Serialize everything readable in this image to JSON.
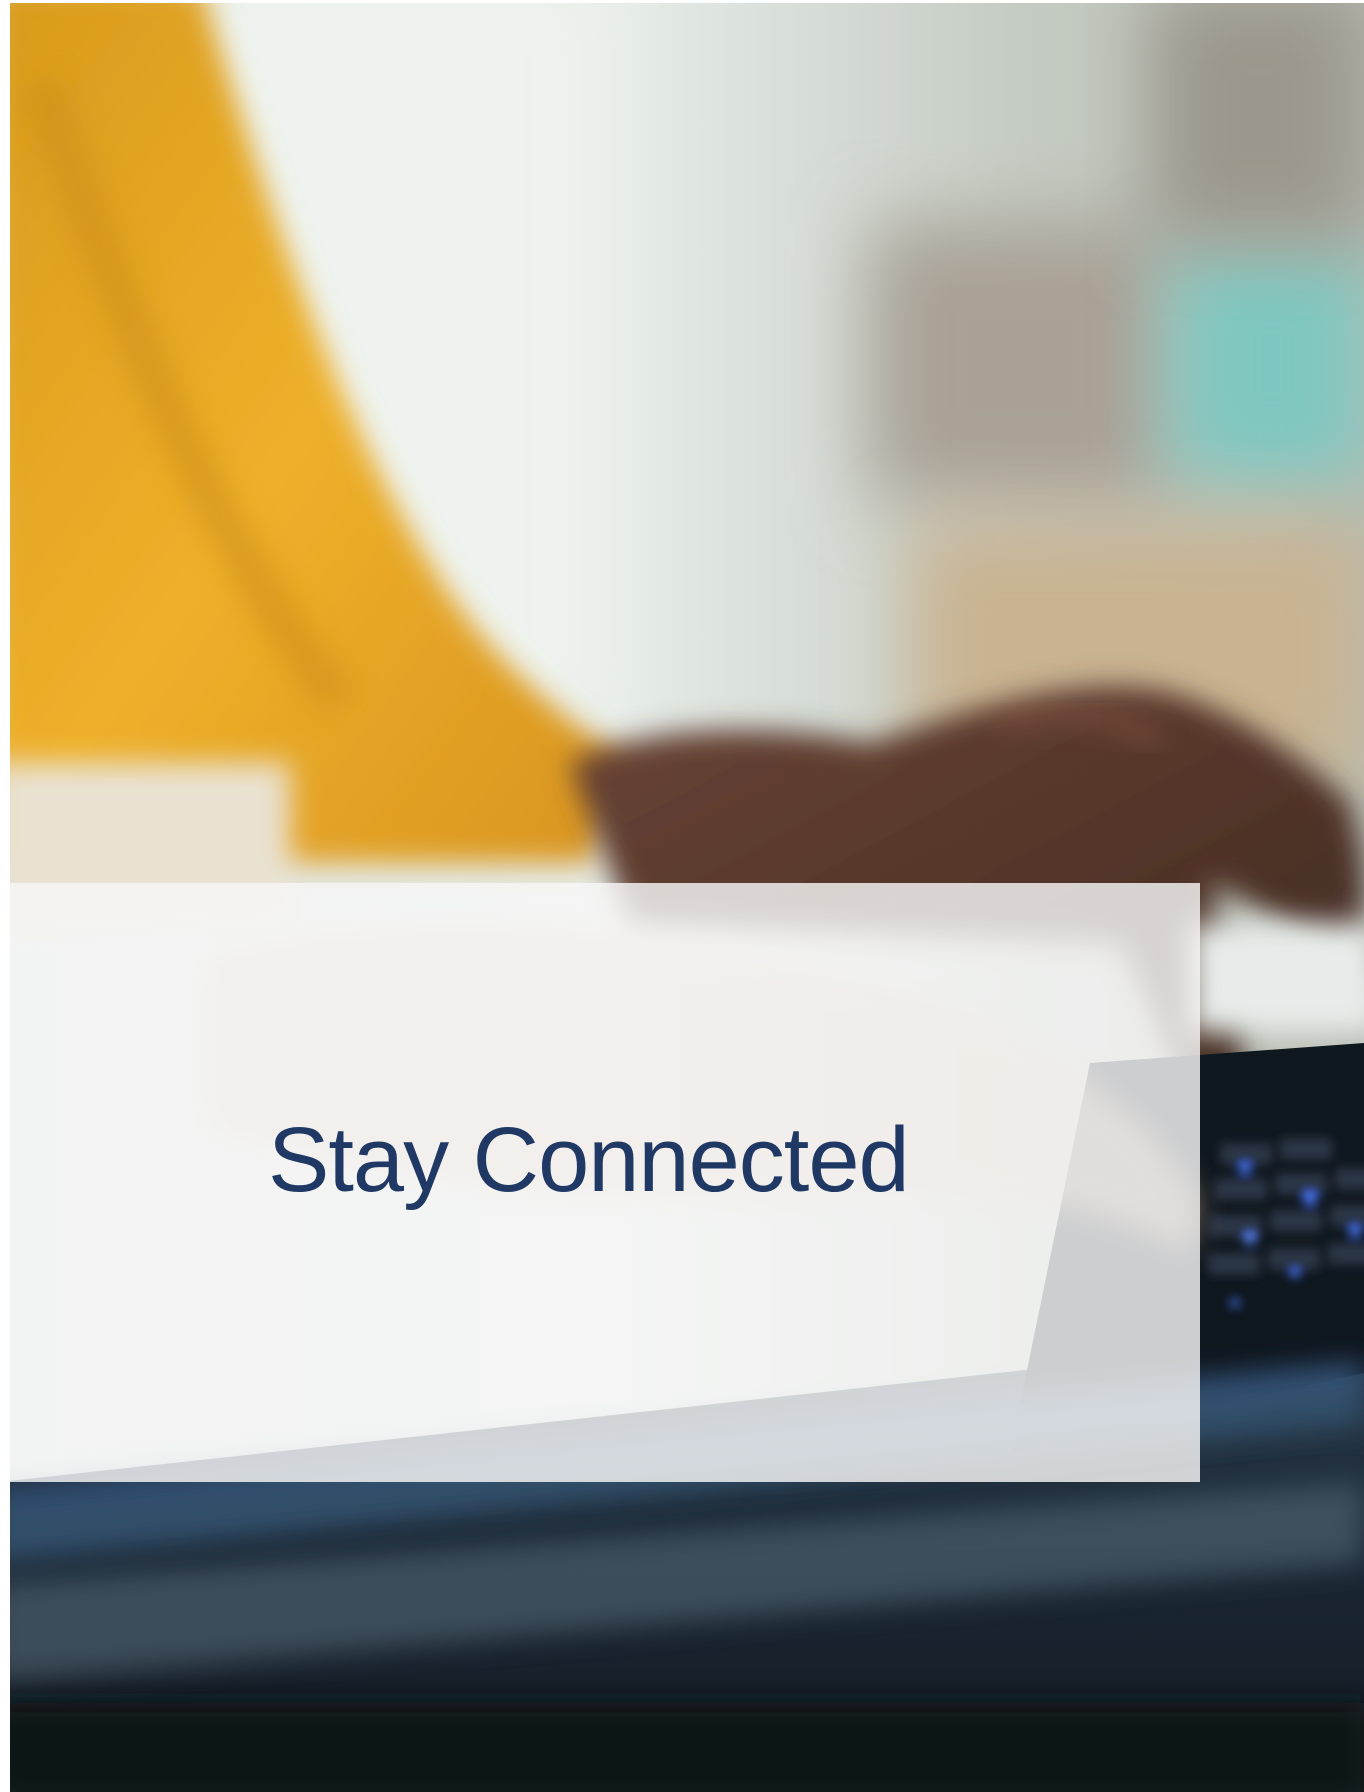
{
  "banner": {
    "title": "Stay Connected"
  },
  "colors": {
    "title_text": "#1f3864",
    "banner_overlay": "#f6f6f6",
    "sweater": "#e8a520",
    "keyboard": "#1c2c3c",
    "keyboard_backlight": "#4a78ff"
  },
  "photo": {
    "subject_icon": "person-typing-on-laptop-photo"
  }
}
